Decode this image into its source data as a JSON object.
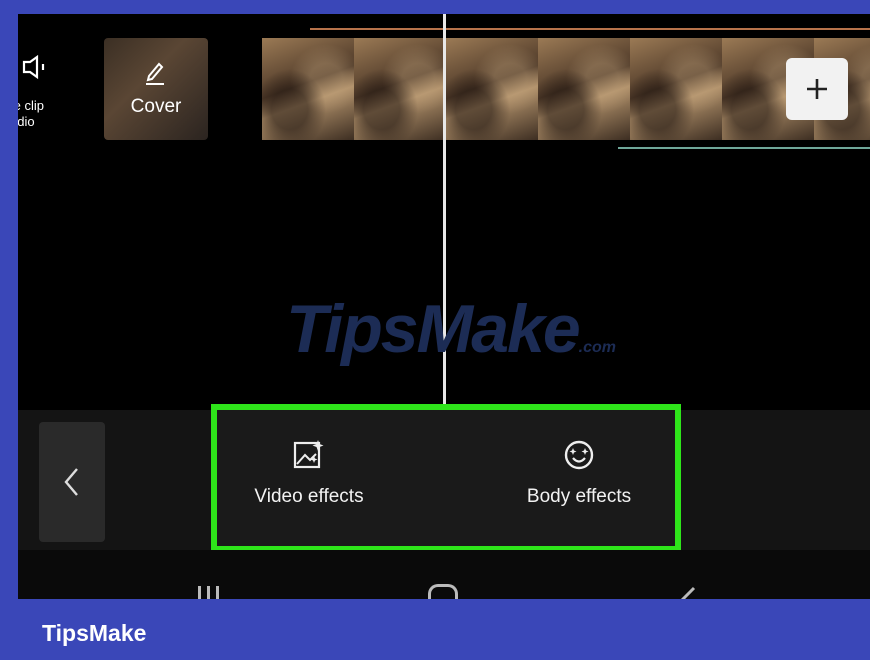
{
  "timeline": {
    "mute_label": "te clip\nudio",
    "cover_label": "Cover",
    "add_clip_symbol": "+"
  },
  "watermark": {
    "text": "TipsMake",
    "suffix": ".com"
  },
  "toolbar": {
    "video_effects_label": "Video effects",
    "body_effects_label": "Body effects"
  },
  "footer": {
    "brand": "TipsMake"
  },
  "colors": {
    "frame_border": "#3a47b8",
    "highlight": "#2ee51a",
    "track_orange": "#b8734b",
    "track_teal": "#6fa79a"
  },
  "icons": {
    "mute": "speaker-icon",
    "cover": "pencil-icon",
    "back": "chevron-left-icon",
    "video_effects": "image-sparkle-icon",
    "body_effects": "smiley-sparkle-icon"
  }
}
